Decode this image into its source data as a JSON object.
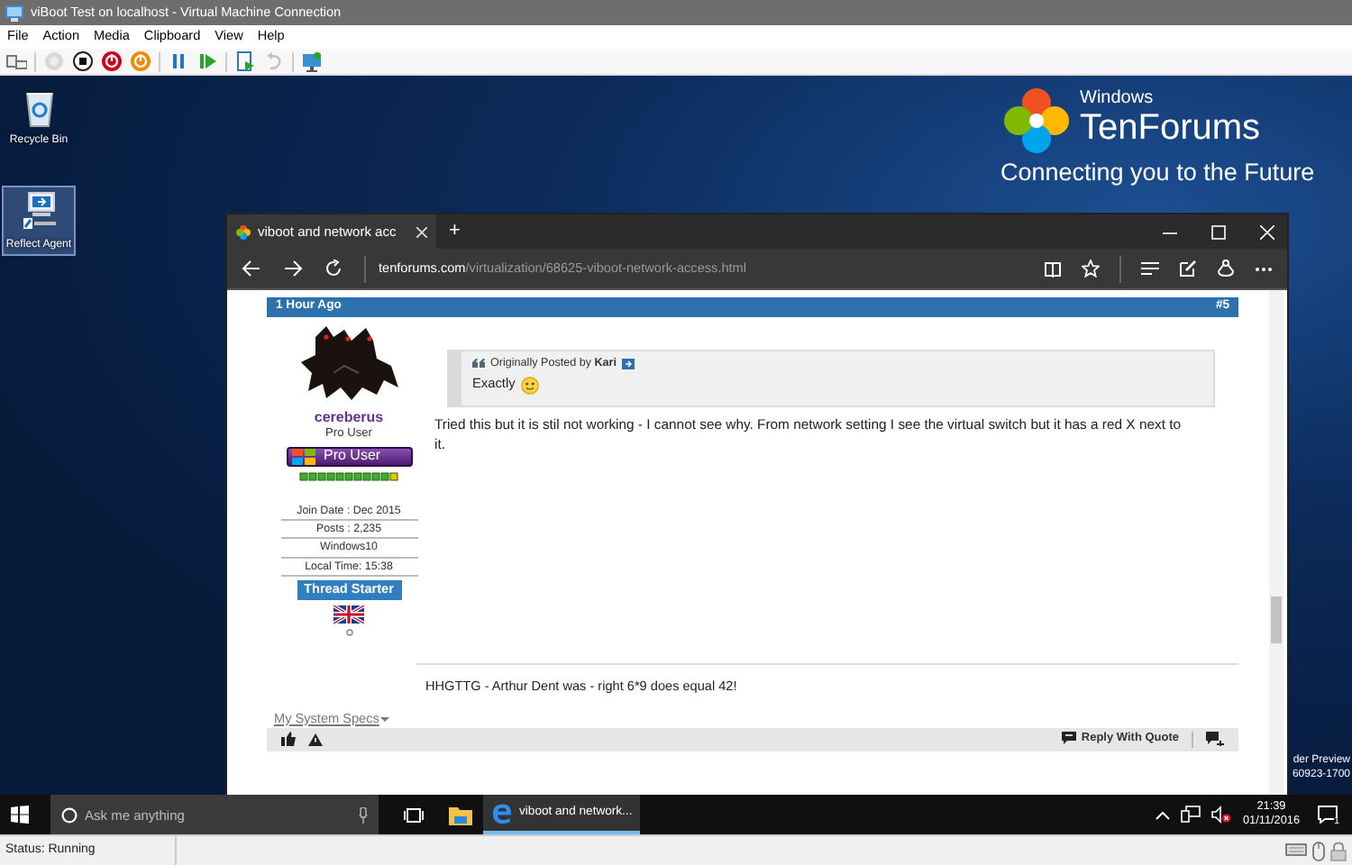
{
  "window": {
    "title": "viBoot Test on localhost - Virtual Machine Connection"
  },
  "menu": [
    "File",
    "Action",
    "Media",
    "Clipboard",
    "View",
    "Help"
  ],
  "toolbar": [
    {
      "kind": "keyboard",
      "disabled": false
    },
    {
      "kind": "separator"
    },
    {
      "kind": "start",
      "disabled": true
    },
    {
      "kind": "turn-off",
      "disabled": false
    },
    {
      "kind": "shut-down",
      "disabled": false
    },
    {
      "kind": "save",
      "disabled": false
    },
    {
      "kind": "separator"
    },
    {
      "kind": "pause",
      "disabled": false
    },
    {
      "kind": "reset",
      "disabled": false
    },
    {
      "kind": "separator"
    },
    {
      "kind": "checkpoint",
      "disabled": false
    },
    {
      "kind": "revert",
      "disabled": true
    },
    {
      "kind": "separator"
    },
    {
      "kind": "enhanced-session",
      "disabled": false
    }
  ],
  "desktop": {
    "icons": [
      {
        "kind": "recycle-bin",
        "label": "Recycle Bin",
        "selected": false
      },
      {
        "kind": "reflect-agent",
        "label": "Reflect Agent",
        "selected": true
      }
    ],
    "logo": {
      "small_text": "Windows",
      "wordmark": "TenForums",
      "tagline": "Connecting you to the Future"
    },
    "build_watermark": [
      "der Preview",
      "60923-1700"
    ]
  },
  "browser": {
    "tabs": [
      {
        "title": "viboot and network acc",
        "selected": true
      }
    ],
    "new_tab": "+",
    "address": {
      "domain": "tenforums.com",
      "path": "/virtualization/68625-viboot-network-access.html"
    },
    "post": {
      "time": "1 Hour Ago",
      "number": "#5",
      "author": {
        "name": "cereberus",
        "title": "Pro User",
        "badge": "Pro User",
        "stats": [
          "Join Date : Dec 2015",
          "Posts : 2,235",
          "Windows10",
          "Local Time: 15:38"
        ],
        "starter": "Thread Starter"
      },
      "quote": {
        "attribution": "Originally Posted by **Kari**",
        "text": "Exactly"
      },
      "body": "Tried this but it is stil not working - I cannot see why. From network setting I see the virtual switch but it has a red X next to it.",
      "signature": "HHGTTG - Arthur Dent was - right 6*9 does equal 42!",
      "specs_link": "My System Specs",
      "reply_with_quote": "Reply With Quote"
    }
  },
  "taskbar": {
    "search_placeholder": "Ask me anything",
    "running_app": {
      "title": "viboot and network...",
      "active": true
    },
    "clock": {
      "time": "21:39",
      "date": "01/11/2016"
    },
    "notifications": "1"
  },
  "status_bar": {
    "text": "Status: Running"
  }
}
